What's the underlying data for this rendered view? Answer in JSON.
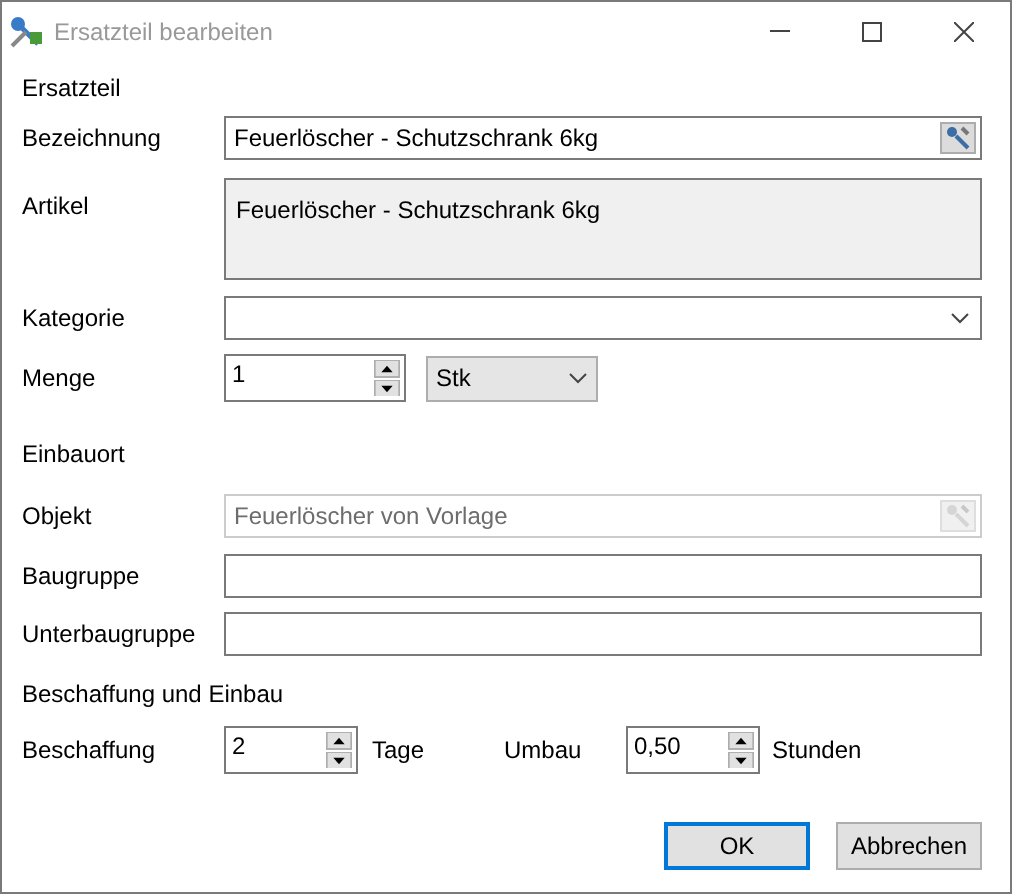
{
  "window": {
    "title": "Ersatzteil bearbeiten"
  },
  "ersatzteil": {
    "heading": "Ersatzteil",
    "bezeichnung": {
      "label": "Bezeichnung",
      "value": "Feuerlöscher - Schutzschrank 6kg"
    },
    "artikel": {
      "label": "Artikel",
      "value": "Feuerlöscher - Schutzschrank 6kg",
      "readonly": true
    },
    "kategorie": {
      "label": "Kategorie"
    },
    "menge": {
      "label": "Menge",
      "value": "1",
      "unit": "Stk"
    }
  },
  "einbauort": {
    "heading": "Einbauort",
    "objekt": {
      "label": "Objekt",
      "value": "Feuerlöscher von Vorlage",
      "disabled": true
    },
    "baugruppe": {
      "label": "Baugruppe"
    },
    "unterbaugruppe": {
      "label": "Unterbaugruppe"
    }
  },
  "beschaffung_und_einbau": {
    "heading": "Beschaffung und Einbau",
    "beschaffung": {
      "label": "Beschaffung",
      "value": "2",
      "unit": "Tage"
    },
    "umbau": {
      "label": "Umbau",
      "value": "0,50",
      "unit": "Stunden"
    }
  },
  "buttons": [
    {
      "label": "OK",
      "default": true
    },
    {
      "label": "Abbrechen",
      "default": false
    }
  ]
}
